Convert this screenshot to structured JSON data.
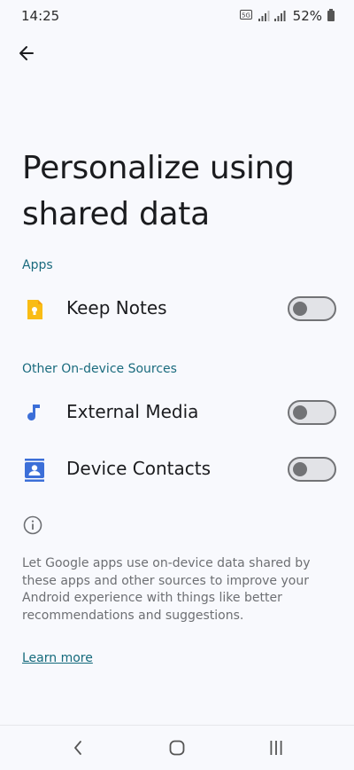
{
  "status_bar": {
    "time": "14:25",
    "battery_percent": "52%",
    "network_badge": "5G"
  },
  "header": {
    "back_icon": "arrow-back-icon"
  },
  "page": {
    "title_line1": "Personalize using",
    "title_line2": "shared data"
  },
  "sections": [
    {
      "header": "Apps",
      "items": [
        {
          "label": "Keep Notes",
          "icon": "keep-notes-icon",
          "enabled": false
        }
      ]
    },
    {
      "header": "Other On-device Sources",
      "items": [
        {
          "label": "External Media",
          "icon": "music-note-icon",
          "enabled": false
        },
        {
          "label": "Device Contacts",
          "icon": "contacts-icon",
          "enabled": false
        }
      ]
    }
  ],
  "info": {
    "icon": "info-icon",
    "description": "Let Google apps use on-device data shared by these apps and other sources to improve your Android experience with things like better recommendations and suggestions.",
    "learn_more": "Learn more"
  },
  "nav_bar": {
    "back": "nav-back-icon",
    "home": "nav-home-icon",
    "recents": "nav-recents-icon"
  },
  "colors": {
    "background": "#f8f9fd",
    "section_header": "#1a6b7e",
    "link": "#146a7c",
    "toggle_off_track": "#e2e3e7",
    "toggle_off_border": "#727376",
    "keep_yellow": "#f9bc15",
    "accent_blue": "#3c6fd8"
  }
}
